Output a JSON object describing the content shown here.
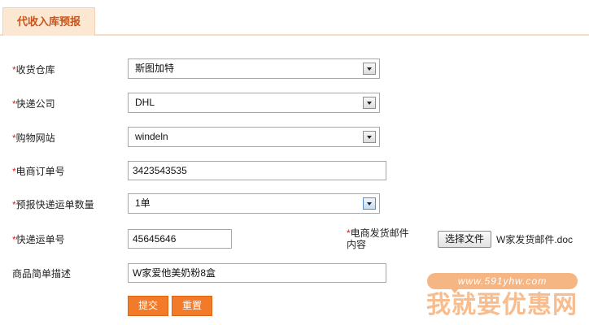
{
  "tab": {
    "title": "代收入库预报"
  },
  "required_mark": "*",
  "fields": {
    "warehouse": {
      "label": "收货仓库",
      "value": "斯图加特"
    },
    "courier": {
      "label": "快递公司",
      "value": "DHL"
    },
    "shop_site": {
      "label": "购物网站",
      "value": "windeln"
    },
    "order_no": {
      "label": "电商订单号",
      "value": "3423543535"
    },
    "waybill_count": {
      "label": "预报快递运单数量",
      "value": "1单"
    },
    "waybill_no": {
      "label": "快递运单号",
      "value": "45645646"
    },
    "ship_email": {
      "label_line1": "电商发货邮件",
      "label_line2": "内容",
      "button": "选择文件",
      "file_name": "W家发货邮件.doc"
    },
    "description": {
      "label": "商品简单描述",
      "value": "W家爱他美奶粉8盒"
    }
  },
  "buttons": {
    "submit": "提交",
    "reset": "重置"
  },
  "watermark": {
    "url": "www.591yhw.com",
    "brand": "我就要优惠网"
  },
  "colors": {
    "accent": "#f37a28",
    "tab_text": "#c8541a",
    "required": "#e01b1b"
  }
}
